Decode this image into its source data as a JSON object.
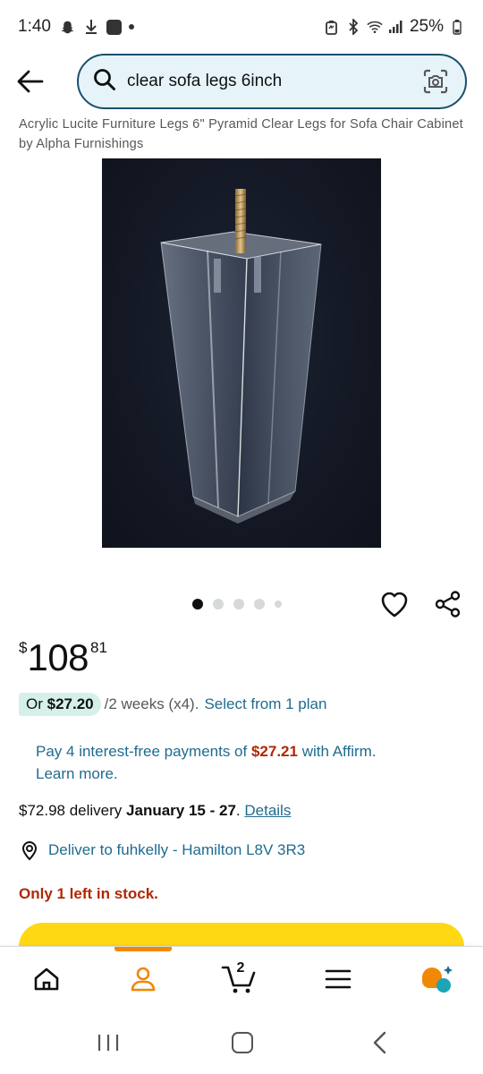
{
  "status_bar": {
    "time": "1:40",
    "battery": "25%",
    "left_icons": [
      "snapchat-icon",
      "download-icon",
      "app-icon",
      "dot-icon"
    ],
    "right_icons": [
      "battery-saver-icon",
      "bluetooth-icon",
      "wifi-icon",
      "signal-icon",
      "battery-icon"
    ]
  },
  "search": {
    "query": "clear sofa legs 6inch",
    "lens_icon": "camera-lens-icon"
  },
  "product": {
    "title": "Acrylic Lucite Furniture Legs 6\" Pyramid Clear Legs for Sofa Chair Cabinet by Alpha Furnishings",
    "carousel": {
      "count": 5,
      "active_index": 0
    },
    "price": {
      "symbol": "$",
      "whole": "108",
      "fraction": "81"
    },
    "installment": {
      "prefix": "Or",
      "amount": "$27.20",
      "terms": "/2 weeks (x4).",
      "link": "Select from 1 plan"
    },
    "affirm": {
      "text_before": "Pay 4 interest-free payments of",
      "amount": "$27.21",
      "text_after": "with Affirm.",
      "learn_more": "Learn more."
    },
    "delivery": {
      "cost": "$72.98 delivery",
      "dates": "January 15 - 27",
      "period": ".",
      "details_link": "Details"
    },
    "deliver_to": "Deliver to fuhkelly - Hamilton L8V 3R3",
    "stock": "Only 1 left in stock."
  },
  "bottom_nav": {
    "items": [
      {
        "name": "home",
        "icon": "home-icon"
      },
      {
        "name": "account",
        "icon": "person-icon",
        "active": true
      },
      {
        "name": "cart",
        "icon": "cart-icon",
        "count": "2"
      },
      {
        "name": "menu",
        "icon": "menu-icon"
      },
      {
        "name": "rufus",
        "icon": "rufus-icon"
      }
    ]
  },
  "colors": {
    "link": "#1f6b8f",
    "price_red": "#b12704",
    "accent_orange": "#f08804",
    "cart_yellow": "#ffd814",
    "search_border": "#1b4f6e",
    "search_bg": "#e6f4fa",
    "installment_pill": "#d5f0ea"
  }
}
